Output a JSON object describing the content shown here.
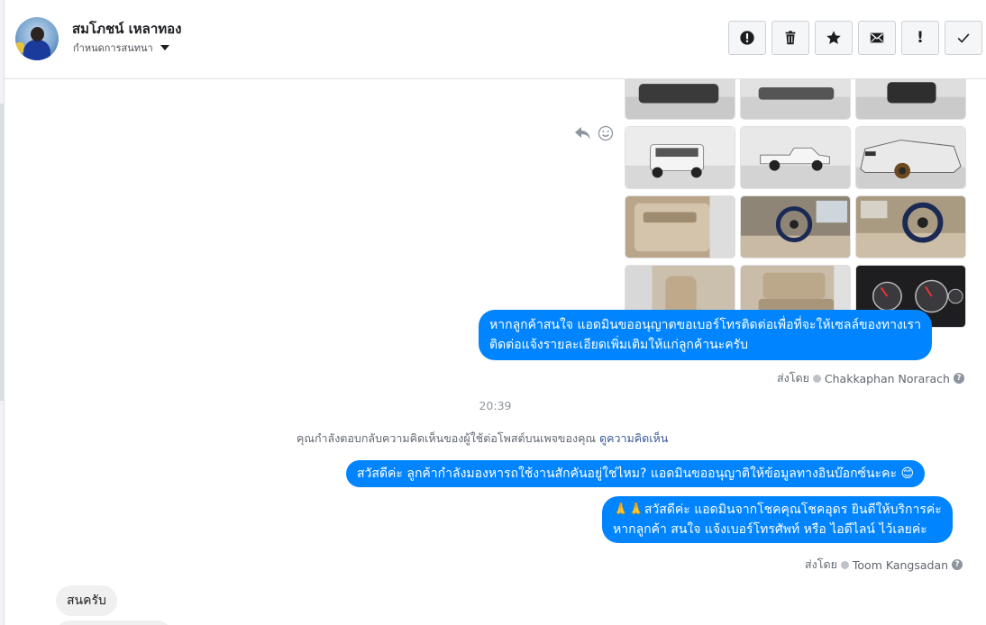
{
  "header": {
    "contact_name": "สมโภชน์ เหลาทอง",
    "subtitle": "กำหนดการสนทนา",
    "actions": [
      {
        "name": "report-button",
        "icon": "alert-circle-icon"
      },
      {
        "name": "delete-button",
        "icon": "trash-icon"
      },
      {
        "name": "star-button",
        "icon": "star-icon"
      },
      {
        "name": "mark-unread-button",
        "icon": "envelope-icon"
      },
      {
        "name": "mark-important-button",
        "icon": "exclamation-icon",
        "label": "!"
      },
      {
        "name": "mark-done-button",
        "icon": "check-icon"
      }
    ]
  },
  "messages": {
    "photos": [
      "car-rear-photo",
      "car-side-photo",
      "car-front-photo",
      "pickup-rear-photo",
      "pickup-side-photo",
      "pickup-front-photo",
      "door-interior-photo",
      "steering-wheel-photo",
      "dashboard-photo",
      "seat-photo",
      "rear-seat-photo",
      "gauge-cluster-photo"
    ],
    "bubble1_line1": "หากลูกค้าสนใจ แอดมินขออนุญาตขอเบอร์โทรติดต่อเพื่อที่จะให้เซลล์ของทางเรา",
    "bubble1_line2": "ติดต่อแจ้งรายละเอียดเพิ่มเติมให้แก่ลูกค้านะครับ",
    "sent_by_label": "ส่งโดย",
    "sender1": "Chakkaphan Norarach",
    "time": "20:39",
    "notice_text": "คุณกำลังตอบกลับความคิดเห็นของผู้ใช้ต่อโพสต์บนเพจของคุณ",
    "notice_link": "ดูความคิดเห็น",
    "bubble2": "สวัสดีค่ะ ลูกค้ากำลังมองหารถใช้งานสักคันอยู่ใช่ไหม? แอดมินขออนุญาติให้ข้อมูลทางอินบ๊อกซ์นะคะ 😊",
    "bubble3_line1": "🙏🙏สวัสดีค่ะ แอดมินจากโชคคุณโชคอุดร ยินดีให้บริการค่ะ",
    "bubble3_line2": "หากลูกค้า สนใจ แจ้งเบอร์โทรศัพท์ หรือ ไอดีไลน์  ไว้เลยค่ะ",
    "sender2": "Toom Kangsadan",
    "incoming1": "สนครับ",
    "help_mark": "?"
  },
  "colors": {
    "outgoing_bubble": "#0084ff",
    "incoming_bubble": "#f1f0f0",
    "link": "#385898"
  }
}
